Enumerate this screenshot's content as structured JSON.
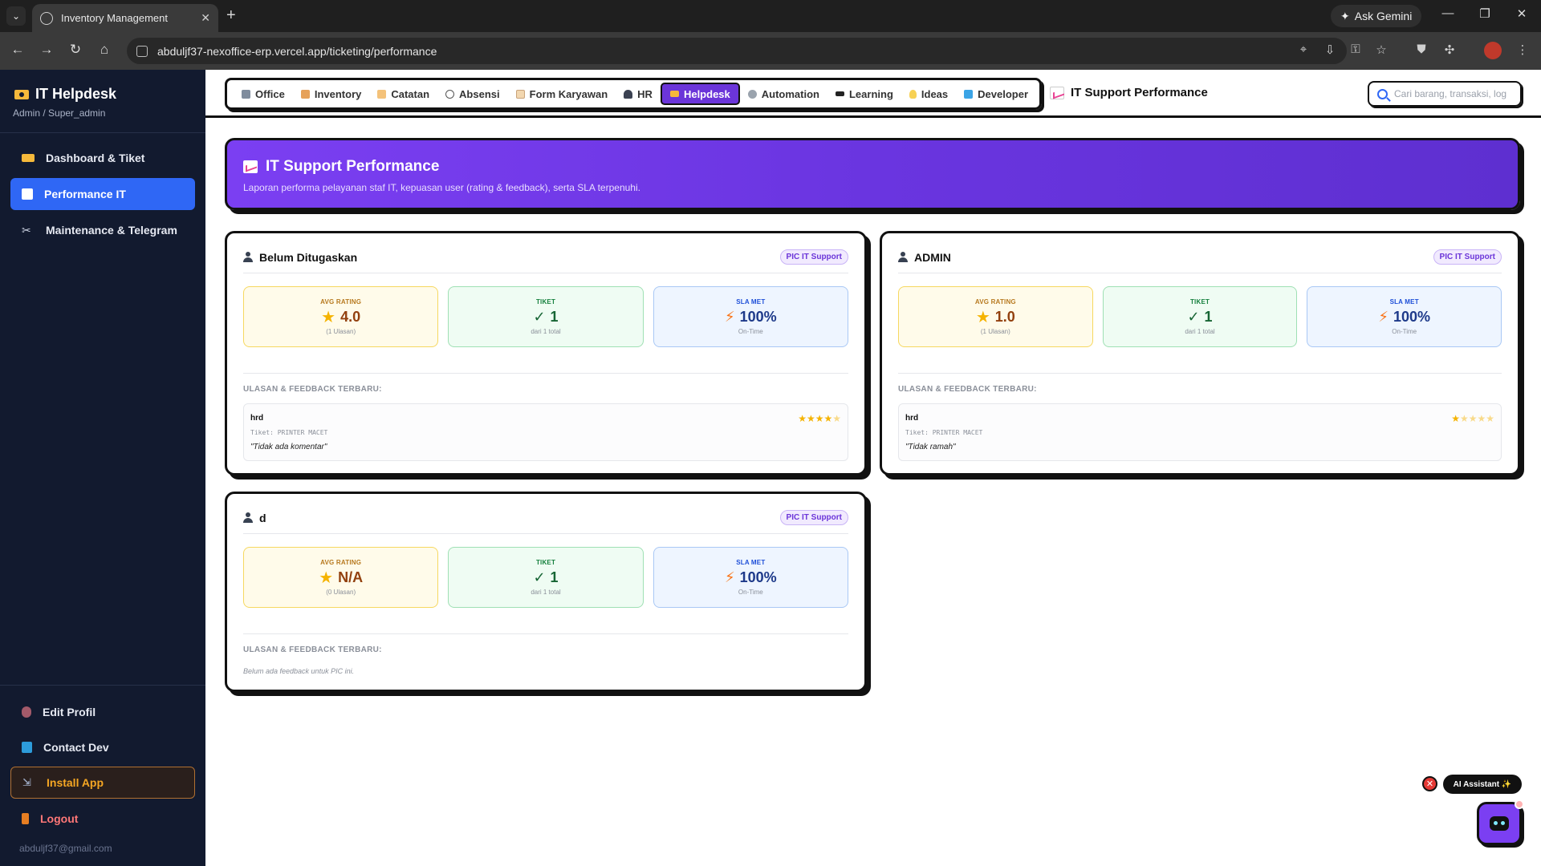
{
  "browser": {
    "tab_title": "Inventory Management",
    "url": "abduljf37-nexoffice-erp.vercel.app/ticketing/performance",
    "ask_gemini": "Ask Gemini"
  },
  "sidebar": {
    "title": "IT Helpdesk",
    "subtitle": "Admin / Super_admin",
    "items": [
      {
        "label": "Dashboard & Tiket"
      },
      {
        "label": "Performance IT"
      },
      {
        "label": "Maintenance & Telegram"
      }
    ],
    "bottom_items": [
      {
        "label": "Edit Profil"
      },
      {
        "label": "Contact Dev"
      },
      {
        "label": "Install App"
      },
      {
        "label": "Logout"
      }
    ],
    "email": "abduljf37@gmail.com"
  },
  "topnav": {
    "items": [
      {
        "label": "Office"
      },
      {
        "label": "Inventory"
      },
      {
        "label": "Catatan"
      },
      {
        "label": "Absensi"
      },
      {
        "label": "Form Karyawan"
      },
      {
        "label": "HR"
      },
      {
        "label": "Helpdesk"
      },
      {
        "label": "Automation"
      },
      {
        "label": "Learning"
      },
      {
        "label": "Ideas"
      },
      {
        "label": "Developer"
      }
    ],
    "page_label": "IT Support Performance",
    "search_placeholder": "Cari barang, transaksi, log..."
  },
  "hero": {
    "title": "IT Support Performance",
    "subtitle": "Laporan performa pelayanan staf IT, kepuasan user (rating & feedback), serta SLA terpenuhi."
  },
  "labels": {
    "avg_rating": "AVG RATING",
    "tiket": "TIKET",
    "sla_met": "SLA MET",
    "on_time": "On-Time",
    "feedback_title": "ULASAN & FEEDBACK TERBARU:"
  },
  "cards": [
    {
      "name": "Belum Ditugaskan",
      "badge": "PIC IT Support",
      "rating": "4.0",
      "rating_sub": "(1 Ulasan)",
      "tiket": "1",
      "tiket_sub": "dari 1 total",
      "sla": "100%",
      "review": {
        "user": "hrd",
        "ticket": "Tiket: PRINTER MACET",
        "comment": "\"Tidak ada komentar\"",
        "stars": 4
      }
    },
    {
      "name": "ADMIN",
      "badge": "PIC IT Support",
      "rating": "1.0",
      "rating_sub": "(1 Ulasan)",
      "tiket": "1",
      "tiket_sub": "dari 1 total",
      "sla": "100%",
      "review": {
        "user": "hrd",
        "ticket": "Tiket: PRINTER MACET",
        "comment": "\"Tidak ramah\"",
        "stars": 1
      }
    },
    {
      "name": "d",
      "badge": "PIC IT Support",
      "rating": "N/A",
      "rating_sub": "(0 Ulasan)",
      "tiket": "1",
      "tiket_sub": "dari 1 total",
      "sla": "100%",
      "no_feedback": "Belum ada feedback untuk PIC ini."
    }
  ],
  "ai": {
    "label": "AI Assistant ✨"
  }
}
